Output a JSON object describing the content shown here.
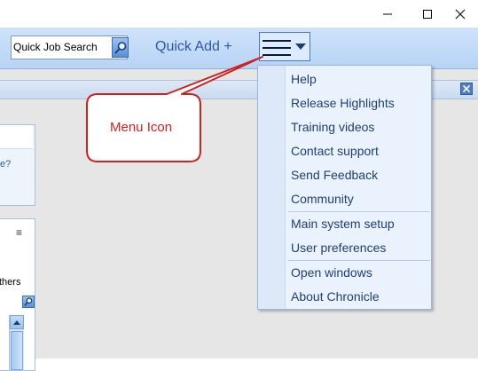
{
  "window": {
    "minimize_icon": "minimize-icon",
    "maximize_icon": "maximize-icon",
    "close_icon": "close-icon"
  },
  "toolbar": {
    "search_placeholder": "Quick Job Search",
    "search_icon": "search-icon",
    "quick_add_label": "Quick Add +",
    "menu_icon": "hamburger-menu-icon"
  },
  "panels": {
    "left_fragment_1": "e?",
    "left_fragment_2": "thers",
    "menu_mini": "≡"
  },
  "callout": {
    "text": "Menu Icon",
    "color": "#cc2222"
  },
  "menu": {
    "items": [
      "Help",
      "Release Highlights",
      "Training videos",
      "Contact support",
      "Send Feedback",
      "Community",
      "Main system setup",
      "User preferences",
      "Open windows",
      "About Chronicle"
    ]
  },
  "colors": {
    "toolbar": "#c4daf8",
    "accent": "#2b5aa7",
    "menu_bg": "#eaf3fd"
  }
}
